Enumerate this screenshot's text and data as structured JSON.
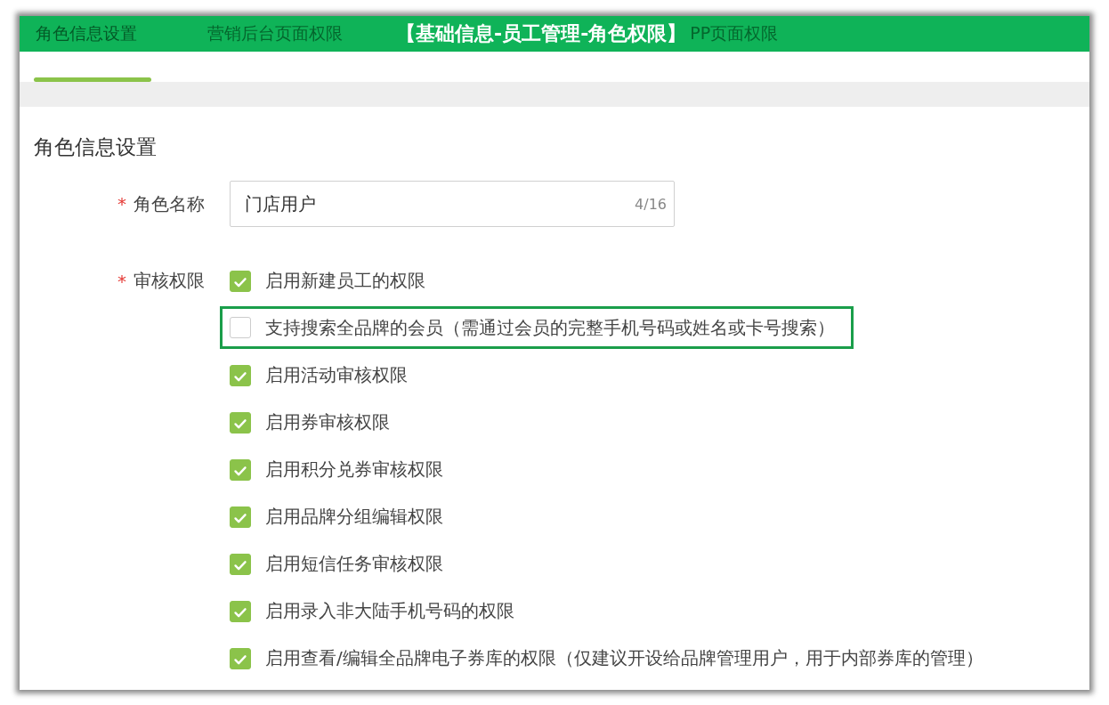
{
  "banner": {
    "title": "【基础信息-员工管理-角色权限】"
  },
  "tabs": [
    {
      "label": "角色信息设置",
      "selected": true
    },
    {
      "label": "营销后台页面权限",
      "selected": false
    },
    {
      "label": "PP页面权限",
      "selected": false
    }
  ],
  "section": {
    "title": "角色信息设置"
  },
  "role_name": {
    "required_mark": "*",
    "label": "角色名称",
    "value": "门店用户",
    "counter": "4/16"
  },
  "review": {
    "required_mark": "*",
    "label": "审核权限",
    "options": [
      {
        "label": "启用新建员工的权限",
        "checked": true,
        "highlighted": false
      },
      {
        "label": "支持搜索全品牌的会员（需通过会员的完整手机号码或姓名或卡号搜索）",
        "checked": false,
        "highlighted": true
      },
      {
        "label": "启用活动审核权限",
        "checked": true,
        "highlighted": false
      },
      {
        "label": "启用券审核权限",
        "checked": true,
        "highlighted": false
      },
      {
        "label": "启用积分兑券审核权限",
        "checked": true,
        "highlighted": false
      },
      {
        "label": "启用品牌分组编辑权限",
        "checked": true,
        "highlighted": false
      },
      {
        "label": "启用短信任务审核权限",
        "checked": true,
        "highlighted": false
      },
      {
        "label": "启用录入非大陆手机号码的权限",
        "checked": true,
        "highlighted": false
      },
      {
        "label": "启用查看/编辑全品牌电子券库的权限（仅建议开设给品牌管理用户，用于内部券库的管理）",
        "checked": true,
        "highlighted": false
      }
    ]
  }
}
